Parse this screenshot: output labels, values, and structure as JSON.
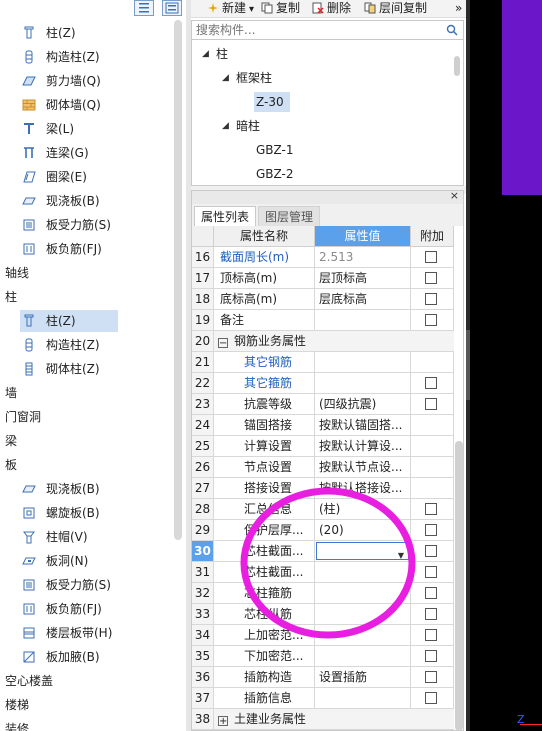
{
  "left_tree": {
    "toolbar_icons": [
      "list-view-icon",
      "detail-view-icon"
    ],
    "items": [
      {
        "label": "柱(Z)",
        "icon": "column-icon",
        "indent": 1,
        "selected": false
      },
      {
        "label": "构造柱(Z)",
        "icon": "constructional-column-icon",
        "indent": 1,
        "selected": false
      },
      {
        "label": "剪力墙(Q)",
        "icon": "shear-wall-icon",
        "indent": 1,
        "selected": false
      },
      {
        "label": "砌体墙(Q)",
        "icon": "masonry-wall-icon",
        "indent": 1,
        "selected": false
      },
      {
        "label": "梁(L)",
        "icon": "beam-icon",
        "indent": 1,
        "selected": false
      },
      {
        "label": "连梁(G)",
        "icon": "coupling-beam-icon",
        "indent": 1,
        "selected": false
      },
      {
        "label": "圈梁(E)",
        "icon": "ring-beam-icon",
        "indent": 1,
        "selected": false
      },
      {
        "label": "现浇板(B)",
        "icon": "cast-slab-icon",
        "indent": 1,
        "selected": false
      },
      {
        "label": "板受力筋(S)",
        "icon": "slab-rebar-icon",
        "indent": 1,
        "selected": false
      },
      {
        "label": "板负筋(FJ)",
        "icon": "slab-neg-rebar-icon",
        "indent": 1,
        "selected": false
      },
      {
        "label": "轴线",
        "icon": "",
        "indent": 0,
        "selected": false
      },
      {
        "label": "柱",
        "icon": "",
        "indent": 0,
        "selected": false
      },
      {
        "label": "柱(Z)",
        "icon": "column-icon",
        "indent": 1,
        "selected": true
      },
      {
        "label": "构造柱(Z)",
        "icon": "constructional-column-icon",
        "indent": 1,
        "selected": false
      },
      {
        "label": "砌体柱(Z)",
        "icon": "masonry-column-icon",
        "indent": 1,
        "selected": false
      },
      {
        "label": "墙",
        "icon": "",
        "indent": 0,
        "selected": false
      },
      {
        "label": "门窗洞",
        "icon": "",
        "indent": 0,
        "selected": false
      },
      {
        "label": "梁",
        "icon": "",
        "indent": 0,
        "selected": false
      },
      {
        "label": "板",
        "icon": "",
        "indent": 0,
        "selected": false
      },
      {
        "label": "现浇板(B)",
        "icon": "cast-slab-icon",
        "indent": 1,
        "selected": false
      },
      {
        "label": "螺旋板(B)",
        "icon": "spiral-slab-icon",
        "indent": 1,
        "selected": false
      },
      {
        "label": "柱帽(V)",
        "icon": "column-cap-icon",
        "indent": 1,
        "selected": false
      },
      {
        "label": "板洞(N)",
        "icon": "slab-hole-icon",
        "indent": 1,
        "selected": false
      },
      {
        "label": "板受力筋(S)",
        "icon": "slab-rebar-icon",
        "indent": 1,
        "selected": false
      },
      {
        "label": "板负筋(FJ)",
        "icon": "slab-neg-rebar-icon",
        "indent": 1,
        "selected": false
      },
      {
        "label": "楼层板带(H)",
        "icon": "floor-strip-icon",
        "indent": 1,
        "selected": false
      },
      {
        "label": "板加腋(B)",
        "icon": "slab-haunch-icon",
        "indent": 1,
        "selected": false
      },
      {
        "label": "空心楼盖",
        "icon": "",
        "indent": 0,
        "selected": false
      },
      {
        "label": "楼梯",
        "icon": "",
        "indent": 0,
        "selected": false
      },
      {
        "label": "装修",
        "icon": "",
        "indent": 0,
        "selected": false
      }
    ]
  },
  "toolbar": {
    "new_label": "新建",
    "new_arrow": "▾",
    "copy_label": "复制",
    "delete_label": "删除",
    "floor_copy_label": "层间复制",
    "more": "»"
  },
  "search": {
    "placeholder": "搜索构件..."
  },
  "component_tree": [
    {
      "label": "柱",
      "caret": "◢",
      "level": 0,
      "selected": false
    },
    {
      "label": "框架柱",
      "caret": "◢",
      "level": 1,
      "selected": false
    },
    {
      "label": "Z-30",
      "caret": "",
      "level": 2,
      "selected": true
    },
    {
      "label": "暗柱",
      "caret": "◢",
      "level": 1,
      "selected": false
    },
    {
      "label": "GBZ-1",
      "caret": "",
      "level": 2,
      "selected": false
    },
    {
      "label": "GBZ-2",
      "caret": "",
      "level": 2,
      "selected": false
    }
  ],
  "props": {
    "close": "×",
    "tabs": [
      {
        "label": "属性列表",
        "active": true
      },
      {
        "label": "图层管理",
        "active": false
      }
    ],
    "headers": {
      "name": "属性名称",
      "value": "属性值",
      "add": "附加"
    },
    "rows": [
      {
        "no": "16",
        "name": "截面周长(m)",
        "value": "2.513",
        "check": true,
        "blue": true,
        "gray": true,
        "sub": false,
        "exp": "",
        "editing": false
      },
      {
        "no": "17",
        "name": "顶标高(m)",
        "value": "层顶标高",
        "check": true,
        "blue": false,
        "gray": false,
        "sub": false,
        "exp": "",
        "editing": false
      },
      {
        "no": "18",
        "name": "底标高(m)",
        "value": "层底标高",
        "check": true,
        "blue": false,
        "gray": false,
        "sub": false,
        "exp": "",
        "editing": false
      },
      {
        "no": "19",
        "name": "备注",
        "value": "",
        "check": true,
        "blue": false,
        "gray": false,
        "sub": false,
        "exp": "",
        "editing": false
      },
      {
        "no": "20",
        "name": "钢筋业务属性",
        "value": "",
        "check": false,
        "blue": false,
        "gray": false,
        "sub": false,
        "exp": "−",
        "editing": false
      },
      {
        "no": "21",
        "name": "其它钢筋",
        "value": "",
        "check": false,
        "blue": true,
        "gray": false,
        "sub": true,
        "exp": "",
        "editing": false
      },
      {
        "no": "22",
        "name": "其它箍筋",
        "value": "",
        "check": true,
        "blue": true,
        "gray": false,
        "sub": true,
        "exp": "",
        "editing": false
      },
      {
        "no": "23",
        "name": "抗震等级",
        "value": "(四级抗震)",
        "check": true,
        "blue": false,
        "gray": false,
        "sub": true,
        "exp": "",
        "editing": false
      },
      {
        "no": "24",
        "name": "锚固搭接",
        "value": "按默认锚固搭...",
        "check": false,
        "blue": false,
        "gray": false,
        "sub": true,
        "exp": "",
        "editing": false
      },
      {
        "no": "25",
        "name": "计算设置",
        "value": "按默认计算设...",
        "check": false,
        "blue": false,
        "gray": false,
        "sub": true,
        "exp": "",
        "editing": false
      },
      {
        "no": "26",
        "name": "节点设置",
        "value": "按默认节点设...",
        "check": false,
        "blue": false,
        "gray": false,
        "sub": true,
        "exp": "",
        "editing": false
      },
      {
        "no": "27",
        "name": "搭接设置",
        "value": "按默认搭接设...",
        "check": false,
        "blue": false,
        "gray": false,
        "sub": true,
        "exp": "",
        "editing": false
      },
      {
        "no": "28",
        "name": "汇总信息",
        "value": "(柱)",
        "check": true,
        "blue": false,
        "gray": false,
        "sub": true,
        "exp": "",
        "editing": false
      },
      {
        "no": "29",
        "name": "保护层厚...",
        "value": "(20)",
        "check": true,
        "blue": false,
        "gray": false,
        "sub": true,
        "exp": "",
        "editing": false
      },
      {
        "no": "30",
        "name": "芯柱截面...",
        "value": "",
        "check": true,
        "blue": false,
        "gray": false,
        "sub": true,
        "exp": "",
        "editing": true
      },
      {
        "no": "31",
        "name": "芯柱截面...",
        "value": "",
        "check": true,
        "blue": false,
        "gray": false,
        "sub": true,
        "exp": "",
        "editing": false
      },
      {
        "no": "32",
        "name": "芯柱箍筋",
        "value": "",
        "check": true,
        "blue": false,
        "gray": false,
        "sub": true,
        "exp": "",
        "editing": false
      },
      {
        "no": "33",
        "name": "芯柱纵筋",
        "value": "",
        "check": true,
        "blue": false,
        "gray": false,
        "sub": true,
        "exp": "",
        "editing": false
      },
      {
        "no": "34",
        "name": "上加密范...",
        "value": "",
        "check": true,
        "blue": false,
        "gray": false,
        "sub": true,
        "exp": "",
        "editing": false
      },
      {
        "no": "35",
        "name": "下加密范...",
        "value": "",
        "check": true,
        "blue": false,
        "gray": false,
        "sub": true,
        "exp": "",
        "editing": false
      },
      {
        "no": "36",
        "name": "插筋构造",
        "value": "设置插筋",
        "check": true,
        "blue": false,
        "gray": false,
        "sub": true,
        "exp": "",
        "editing": false
      },
      {
        "no": "37",
        "name": "插筋信息",
        "value": "",
        "check": true,
        "blue": false,
        "gray": false,
        "sub": true,
        "exp": "",
        "editing": false
      },
      {
        "no": "38",
        "name": "土建业务属性",
        "value": "",
        "check": false,
        "blue": false,
        "gray": false,
        "sub": false,
        "exp": "+",
        "editing": false
      }
    ]
  },
  "viewport": {
    "axis_label": "Z",
    "accent": "#6b17c9",
    "annotation_color": "#e81ee0"
  }
}
